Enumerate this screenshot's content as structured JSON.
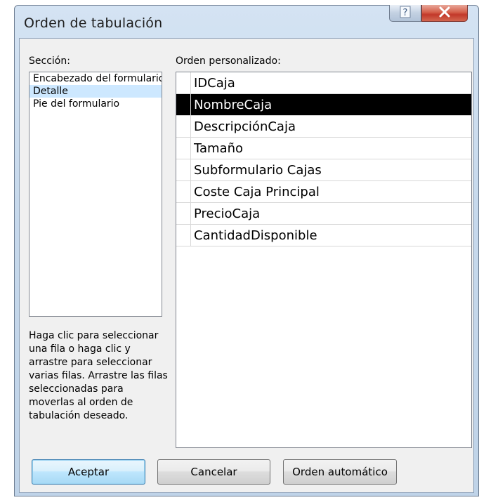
{
  "window": {
    "title": "Orden de tabulación",
    "help_glyph": "?",
    "close_glyph": "X"
  },
  "section": {
    "label": "Sección:",
    "items": [
      {
        "label": "Encabezado del formulario"
      },
      {
        "label": "Detalle"
      },
      {
        "label": "Pie del formulario"
      }
    ],
    "selected": "Detalle"
  },
  "help_text": "Haga clic para seleccionar una fila o haga clic y arrastre para seleccionar varias filas. Arrastre las filas seleccionadas para moverlas al orden de tabulación deseado.",
  "custom_order": {
    "label": "Orden personalizado:",
    "fields": [
      {
        "label": "IDCaja"
      },
      {
        "label": "NombreCaja"
      },
      {
        "label": "DescripciónCaja"
      },
      {
        "label": "Tamaño"
      },
      {
        "label": "Subformulario Cajas"
      },
      {
        "label": "Coste Caja Principal"
      },
      {
        "label": "PrecioCaja"
      },
      {
        "label": "CantidadDisponible"
      }
    ],
    "selected": "NombreCaja"
  },
  "buttons": {
    "ok": "Aceptar",
    "cancel": "Cancelar",
    "auto_order": "Orden automático"
  }
}
